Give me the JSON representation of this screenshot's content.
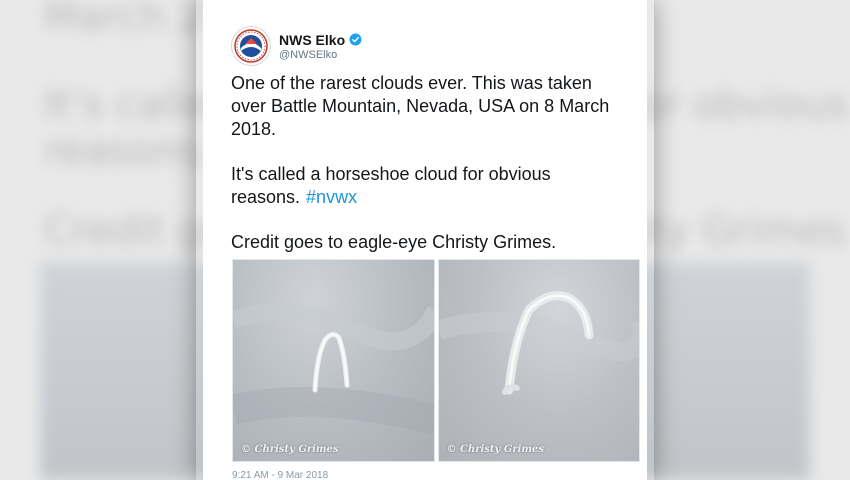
{
  "tweet": {
    "display_name": "NWS Elko",
    "handle": "@NWSElko",
    "paragraphs": [
      "One of the rarest clouds ever. This was taken over Battle Mountain, Nevada, USA on 8 March 2018.",
      "It's called a horseshoe cloud for obvious reasons.",
      "Credit goes to eagle-eye Christy Grimes."
    ],
    "hashtag": "#nvwx",
    "timestamp": "9:21 AM - 9 Mar 2018"
  },
  "media": {
    "photos": [
      {
        "watermark": "© Christy Grimes",
        "icon": "horseshoe-cloud-photo"
      },
      {
        "watermark": "© Christy Grimes",
        "icon": "horseshoe-cloud-photo"
      }
    ]
  },
  "icons": {
    "avatar": "noaa-nws-logo",
    "verified": "verified-badge-icon"
  },
  "colors": {
    "link": "#1b95e0",
    "verified": "#1da1f2",
    "text": "#14171a",
    "secondary": "#657786"
  }
}
